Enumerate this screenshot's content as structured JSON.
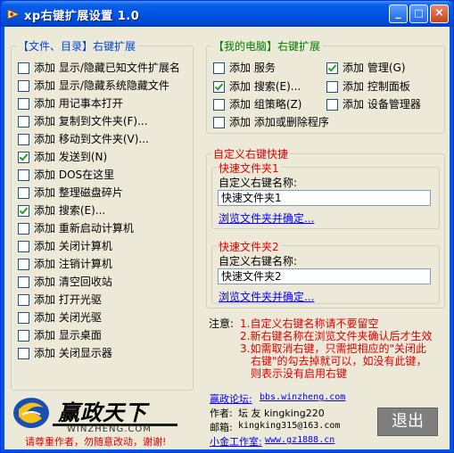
{
  "window": {
    "title": "xp右键扩展设置 1.0",
    "buttons": {
      "minimize": "_",
      "maximize": "□",
      "close": "×"
    }
  },
  "group_files": {
    "title": "【文件、目录】右键扩展",
    "items": [
      {
        "prefix": "添加",
        "text": "显示/隐藏已知文件扩展名",
        "checked": false
      },
      {
        "prefix": "添加",
        "text": "显示/隐藏系统隐藏文件",
        "checked": false
      },
      {
        "prefix": "添加",
        "text": "用记事本打开",
        "checked": false
      },
      {
        "prefix": "添加",
        "text": "复制到文件夹(F)...",
        "checked": false
      },
      {
        "prefix": "添加",
        "text": "移动到文件夹(V)...",
        "checked": false
      },
      {
        "prefix": "添加",
        "text": "发送到(N)",
        "checked": true
      },
      {
        "prefix": "添加",
        "text": "DOS在这里",
        "checked": false
      },
      {
        "prefix": "添加",
        "text": "整理磁盘碎片",
        "checked": false
      },
      {
        "prefix": "添加",
        "text": "搜索(E)...",
        "checked": true
      },
      {
        "prefix": "添加",
        "text": "重新启动计算机",
        "checked": false
      },
      {
        "prefix": "添加",
        "text": "关闭计算机",
        "checked": false
      },
      {
        "prefix": "添加",
        "text": "注销计算机",
        "checked": false
      },
      {
        "prefix": "添加",
        "text": "清空回收站",
        "checked": false
      },
      {
        "prefix": "添加",
        "text": "打开光驱",
        "checked": false
      },
      {
        "prefix": "添加",
        "text": "关闭光驱",
        "checked": false
      },
      {
        "prefix": "添加",
        "text": "显示桌面",
        "checked": false
      },
      {
        "prefix": "添加",
        "text": "关闭显示器",
        "checked": false
      }
    ]
  },
  "group_mycomputer": {
    "title": "【我的电脑】右键扩展",
    "items": [
      {
        "prefix": "添加",
        "text": "服务",
        "checked": false
      },
      {
        "prefix": "添加",
        "text": "管理(G)",
        "checked": true
      },
      {
        "prefix": "添加",
        "text": "搜索(E)...",
        "checked": true
      },
      {
        "prefix": "添加",
        "text": "控制面板",
        "checked": false
      },
      {
        "prefix": "添加",
        "text": "组策略(Z)",
        "checked": false
      },
      {
        "prefix": "添加",
        "text": "设备管理器",
        "checked": false
      },
      {
        "prefix": "添加",
        "text": "添加或删除程序",
        "checked": false
      }
    ]
  },
  "custom": {
    "title": "自定义右键快捷",
    "folder1": {
      "title": "快速文件夹1",
      "name_label": "自定义右键名称:",
      "value": "快速文件夹1",
      "browse": "浏览文件夹并确定..."
    },
    "folder2": {
      "title": "快速文件夹2",
      "name_label": "自定义右键名称:",
      "value": "快速文件夹2",
      "browse": "浏览文件夹并确定..."
    }
  },
  "notes": {
    "label": "注意:",
    "lines": [
      "1.自定义右键名称请不要留空",
      "2.新右键名称在浏览文件夹确认后才生效",
      "3.如需取消右键，只需把相应的\"关闭此",
      "右键\"的勾去掉就可以，如没有此键，",
      "则表示没有启用右键"
    ]
  },
  "footer": {
    "logo_text": "赢政天下",
    "logo_url": "WINZHENG.COM",
    "slogan": "请尊重作者，勿随意改动，谢谢!",
    "forum_label": "赢政论坛:",
    "forum_url": "bbs.winzheng.com",
    "author_label": "作者:",
    "author": "坛 友 kingking220",
    "email_label": "邮箱:",
    "email": "kingking315@163.com",
    "studio_label": "小金工作室:",
    "studio_url": "www.gz1888.cn",
    "exit": "退出"
  },
  "colors": {
    "titlebar": "#0055e5",
    "client": "#ece9d8",
    "link": "#0000ff",
    "note_red": "#e00000",
    "group_blue": "#0046d5",
    "group_green": "#008000"
  }
}
